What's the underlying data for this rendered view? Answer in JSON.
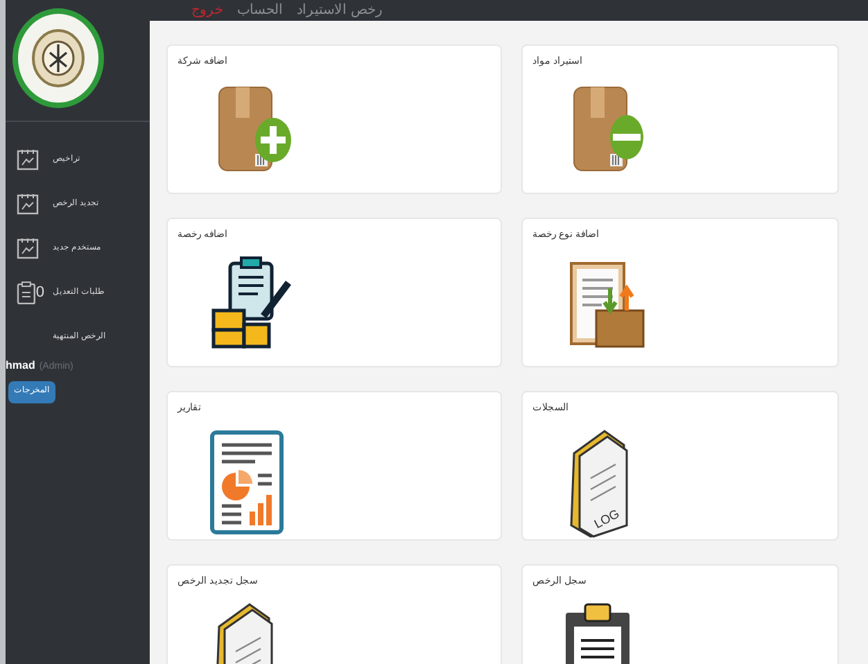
{
  "top_nav": [
    {
      "label": "رخص الاستيراد",
      "kind": "link"
    },
    {
      "label": "الحساب",
      "kind": "link"
    },
    {
      "label": "خروج",
      "kind": "logout"
    }
  ],
  "sidebar": {
    "items": [
      {
        "label": "تراخيص",
        "kind": "calendar"
      },
      {
        "label": "تجديد الرخص",
        "kind": "calendar"
      },
      {
        "label": "مستخدم جديد",
        "kind": "calendar"
      },
      {
        "label": "طلبات التعديل",
        "kind": "clipboard",
        "count": "0"
      },
      {
        "label": "الرخص المنتهية",
        "kind": "plain"
      }
    ],
    "user": {
      "name": "hmad",
      "role": "(Admin)"
    },
    "button": "المخرجات"
  },
  "cards": [
    {
      "title": "استيراد مواد",
      "kind": "box-remove"
    },
    {
      "title": "اضافه شركة",
      "kind": "box-add"
    },
    {
      "title": "اضافة نوع رخصة",
      "kind": "document-box"
    },
    {
      "title": "اضافه رخصة",
      "kind": "clipboard-boxes"
    },
    {
      "title": "السجلات",
      "kind": "log",
      "icon_text": "LOG"
    },
    {
      "title": "تقارير",
      "kind": "report"
    },
    {
      "title": "سجل الرخص",
      "kind": "clipboard"
    },
    {
      "title": "سجل تجديد الرخص",
      "kind": "log"
    }
  ]
}
